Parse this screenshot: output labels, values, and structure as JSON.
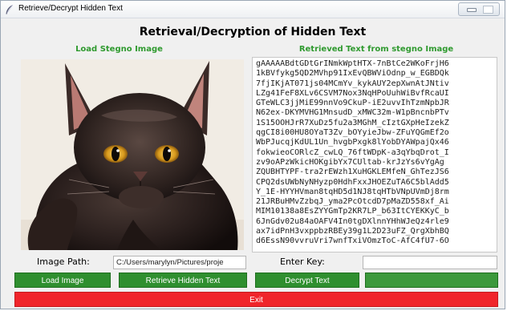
{
  "window": {
    "title": "Retrieve/Decrypt Hidden Text"
  },
  "heading": "Retrieval/Decryption of Hidden Text",
  "load_section": {
    "title": "Load Stegno Image"
  },
  "retrieved_section": {
    "title": "Retrieved Text from stegno Image",
    "lines": [
      "gAAAAABdtGDtGrINmkWptHTX-7nBtCe2WKoFrjH6",
      "1kBVfykg5QD2MVhp91IxEvQBWViOdnp_w_EGBDQk",
      "7fjIKjAT071js04MCmYv_kykAUY2epXwnAtJNtiv",
      "LZg41FeF8XLv6CSVM7Nox3NqHPoUuhWiBvfRcaUI",
      "GTeWLC3jjMiE99nnVo9CkuP-iE2uvvIhTzmNpbJR",
      "N62ex-DKYMVHG1MnsudD_xMWC32m-W1pBncnbPTv",
      "1S15OOHJrR7XuDz5fu2a3MGhM_cIztGXpHeIzekZ",
      "qgCI8i00HU8OYaT3Zv_bOYyieJbw-ZFuYQGmEf2o",
      "WbPJucqjKdUL1Un_hvgbPxgk8lYobDYAWpajQx46",
      "fokwieoCORlcZ_cwLQ_76ftWDpK-a3qYbqDrot_I",
      "zv9oAPzWkicHOKgibYx7CUltab-krJzYs6vYgAg",
      "ZQUBHTYPF-tra2rEWzh1XuHGKLEMfeN_GhTezJS6",
      "CPQ2dsUWbNyNHyzp0HdhFxxJHOEZuTA6C5blAdd5",
      "Y_1E-HYYHVman8tqHD5d1NJ8tqHTbVNpUVmDj8rm",
      "21JRBuHMvZzbqJ_yma2PcOtcdD7pMaZD558xf_Ai",
      "MIM10138a8EsZYYGmTp2KR7LP_b63ItCYEKKyC_b",
      "6JnGdv02u84aOAFV4In0tgDXlnnYHhWJeQz4rle9",
      "ax7idPnH3vxppbzRBEy39g1L2D23uFZ_QrgXbhBQ",
      "d6EssN90vvruVri7wnfTxiVOmzToC-AfC4fU7-6O"
    ]
  },
  "form": {
    "image_path_label": "Image Path:",
    "image_path_value": "C:/Users/marylyn/Pictures/proje",
    "key_label": "Enter Key:",
    "key_value": ""
  },
  "buttons": {
    "load_image": "Load Image",
    "retrieve": "Retrieve Hidden Text",
    "decrypt": "Decrypt Text",
    "save": "",
    "exit": "Exit"
  },
  "colors": {
    "section_title": "#2f9a2f",
    "button_green": "#2f8f2f",
    "exit_red": "#f0252b"
  }
}
